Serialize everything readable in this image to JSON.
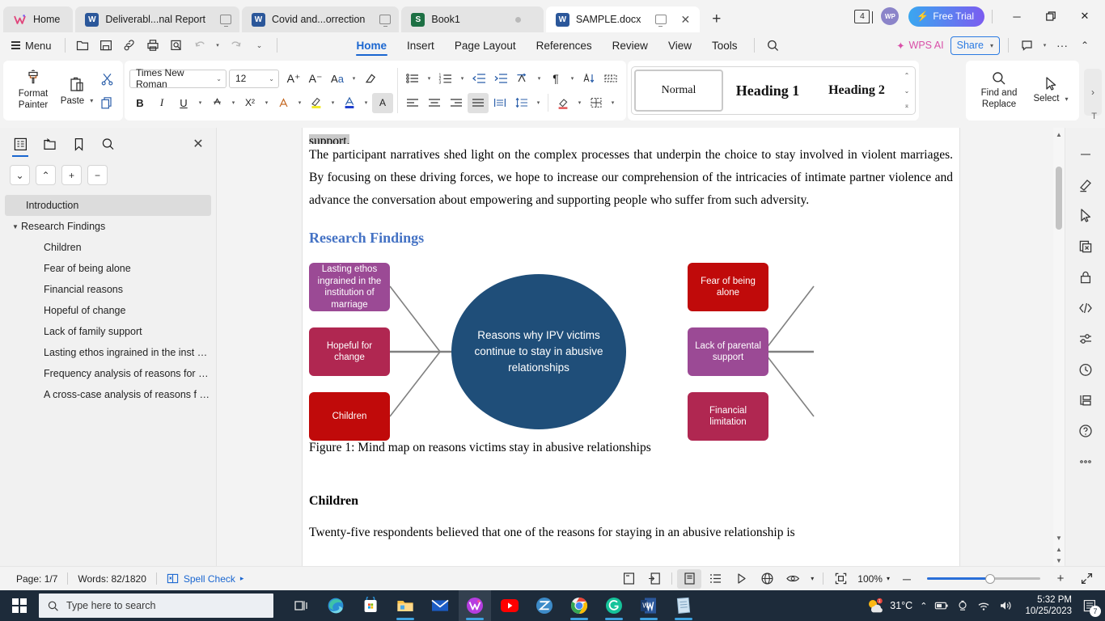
{
  "window": {
    "tabs": [
      {
        "label": "Home",
        "icon": "wps-logo-icon",
        "type": "home",
        "active": false
      },
      {
        "label": "Deliverabl...nal Report",
        "icon": "word-doc-icon",
        "type": "doc",
        "active": false
      },
      {
        "label": "Covid and...orrection",
        "icon": "word-doc-icon",
        "type": "doc",
        "active": false
      },
      {
        "label": "Book1",
        "icon": "spreadsheet-icon",
        "type": "sheet",
        "active": false
      },
      {
        "label": "SAMPLE.docx",
        "icon": "word-doc-icon",
        "type": "doc",
        "active": true
      }
    ],
    "new_tab_label": "+",
    "doc_count": "4",
    "account_initials": "WP",
    "free_trial_label": "Free Trial",
    "minimize_label": "─",
    "restore_label": "❐",
    "close_label": "✕"
  },
  "menubar": {
    "menu_label": "Menu",
    "quick_icons": [
      "new-file-icon",
      "save-icon",
      "share-link-icon",
      "print-icon",
      "print-preview-icon",
      "undo-icon",
      "redo-icon",
      "customize-qat-icon"
    ],
    "tabs": [
      {
        "label": "Home",
        "selected": true
      },
      {
        "label": "Insert",
        "selected": false
      },
      {
        "label": "Page Layout",
        "selected": false
      },
      {
        "label": "References",
        "selected": false
      },
      {
        "label": "Review",
        "selected": false
      },
      {
        "label": "View",
        "selected": false
      },
      {
        "label": "Tools",
        "selected": false
      }
    ],
    "search_icon": "search-icon",
    "wps_ai_label": "WPS AI",
    "share_label": "Share",
    "comment_icon": "comment-icon",
    "more_label": "···",
    "collapse_label": "⌃"
  },
  "ribbon": {
    "format_painter_label": "Format\nPainter",
    "format_painter_line1": "Format",
    "format_painter_line2": "Painter",
    "paste_label": "Paste",
    "cut_label": "Cut",
    "copy_label": "Copy",
    "font_name": "Times New Roman",
    "font_size": "12",
    "grow_font_label": "A⁺",
    "shrink_font_label": "A⁻",
    "change_case_label": "Aa",
    "clear_format_label": "clear-formatting-icon",
    "bold_label": "B",
    "italic_label": "I",
    "underline_label": "U",
    "strikethrough_label": "abc",
    "superscript_label": "X²",
    "text_effects_label": "A",
    "highlight_label": "highlight-icon",
    "font_color_label": "A",
    "text_box_label": "A",
    "bullets_label": "bullet-list-icon",
    "numbering_label": "numbered-list-icon",
    "decrease_indent_label": "decrease-indent-icon",
    "increase_indent_label": "increase-indent-icon",
    "asian_layout_label": "asian-layout-icon",
    "show_marks_label": "¶",
    "sort_label": "sort-icon",
    "borders_grid_label": "grid-icon",
    "align_left_label": "align-left-icon",
    "align_center_label": "align-center-icon",
    "align_right_label": "align-right-icon",
    "align_justify_label": "align-justify-icon",
    "distribute_label": "distribute-icon",
    "line_spacing_label": "line-spacing-icon",
    "shading_label": "shading-icon",
    "border_label": "border-icon",
    "styles": [
      {
        "label": "Normal",
        "selected": true
      },
      {
        "label": "Heading 1",
        "selected": false
      },
      {
        "label": "Heading 2",
        "selected": false
      }
    ],
    "find_replace_line1": "Find and",
    "find_replace_line2": "Replace",
    "select_label": "Select",
    "expand_label": "›",
    "truncated_label": "T"
  },
  "navpane": {
    "tabs": [
      "outline-icon",
      "pages-icon",
      "bookmark-icon",
      "search-icon"
    ],
    "close_label": "✕",
    "controls": [
      "⌄",
      "⌃",
      "+",
      "−"
    ],
    "items": [
      {
        "label": "Introduction",
        "level": 1,
        "selected": true,
        "expandable": false
      },
      {
        "label": "Research Findings",
        "level": 1,
        "selected": false,
        "expandable": true
      },
      {
        "label": "Children",
        "level": 2,
        "selected": false,
        "expandable": false
      },
      {
        "label": "Fear of being alone",
        "level": 2,
        "selected": false,
        "expandable": false
      },
      {
        "label": "Financial reasons",
        "level": 2,
        "selected": false,
        "expandable": false
      },
      {
        "label": "Hopeful of change",
        "level": 2,
        "selected": false,
        "expandable": false
      },
      {
        "label": "Lack of family support",
        "level": 2,
        "selected": false,
        "expandable": false
      },
      {
        "label": "Lasting ethos ingrained in the inst …",
        "level": 2,
        "selected": false,
        "expandable": false
      },
      {
        "label": "Frequency analysis of reasons for …",
        "level": 2,
        "selected": false,
        "expandable": false
      },
      {
        "label": "A cross-case analysis of reasons f …",
        "level": 2,
        "selected": false,
        "expandable": false
      }
    ]
  },
  "document": {
    "partial_top_word": "support.",
    "paragraph_1": "The participant narratives shed light on the complex processes that underpin the choice to stay involved in violent marriages. By focusing on these driving forces, we hope to increase our comprehension of the intricacies of intimate partner violence and advance the conversation about empowering and supporting people who suffer from such adversity.",
    "heading_research_findings": "Research Findings",
    "figure_caption": "Figure 1: Mind map on reasons victims stay in abusive relationships",
    "heading_children": "Children",
    "paragraph_2": "Twenty-five respondents believed that one of the reasons for staying in an abusive relationship is"
  },
  "mindmap": {
    "center_label": "Reasons why IPV victims continue to stay in abusive relationships",
    "center_color": "#1F4E79",
    "left_nodes": [
      {
        "label": "Lasting ethos ingrained in the institution of marriage",
        "color": "#9B4A95"
      },
      {
        "label": "Hopeful for change",
        "color": "#B02751"
      },
      {
        "label": "Children",
        "color": "#C00A0A"
      }
    ],
    "right_nodes": [
      {
        "label": "Fear of being alone",
        "color": "#C00A0A"
      },
      {
        "label": "Lack of parental support",
        "color": "#9B4A95"
      },
      {
        "label": "Financial limitation",
        "color": "#B02751"
      }
    ],
    "connector_color": "#808080"
  },
  "vertical_toolbar": {
    "items": [
      "collapse-icon",
      "pen-highlighter-icon",
      "cursor-select-icon",
      "delete-page-icon",
      "lock-icon",
      "code-icon",
      "settings-sliders-icon",
      "history-icon",
      "outline-view-icon",
      "help-icon",
      "more-options-icon"
    ]
  },
  "statusbar": {
    "page_label": "Page: 1/7",
    "words_label": "Words: 82/1820",
    "spell_check_label": "Spell Check",
    "spell_check_arrow": "▸",
    "view_icons": [
      "full-screen-reading-icon",
      "web-layout-icon",
      "print-layout-icon",
      "outline-icon",
      "presentation-icon",
      "web-view-icon",
      "eye-view-icon",
      "focus-mode-icon"
    ],
    "zoom_label": "100%",
    "zoom_out_label": "─",
    "zoom_in_label": "+",
    "fullscreen_label": "fullscreen-icon"
  },
  "taskbar": {
    "start_label": "start-button",
    "search_placeholder": "Type here to search",
    "task_view_label": "task-view-icon",
    "apps": [
      {
        "name": "edge-icon",
        "running": false,
        "focused": false
      },
      {
        "name": "microsoft-store-icon",
        "running": false,
        "focused": false
      },
      {
        "name": "file-explorer-icon",
        "running": true,
        "focused": false
      },
      {
        "name": "mail-icon",
        "running": false,
        "focused": false
      },
      {
        "name": "wps-office-icon",
        "running": true,
        "focused": true
      },
      {
        "name": "youtube-icon",
        "running": false,
        "focused": false
      },
      {
        "name": "zotero-icon",
        "running": false,
        "focused": false
      },
      {
        "name": "chrome-icon",
        "running": true,
        "focused": false
      },
      {
        "name": "grammarly-icon",
        "running": true,
        "focused": false
      },
      {
        "name": "word-icon",
        "running": true,
        "focused": false
      },
      {
        "name": "notepad-icon",
        "running": true,
        "focused": false
      }
    ],
    "temperature": "31°C",
    "time": "5:32 PM",
    "date": "10/25/2023",
    "notification_count": "7"
  }
}
